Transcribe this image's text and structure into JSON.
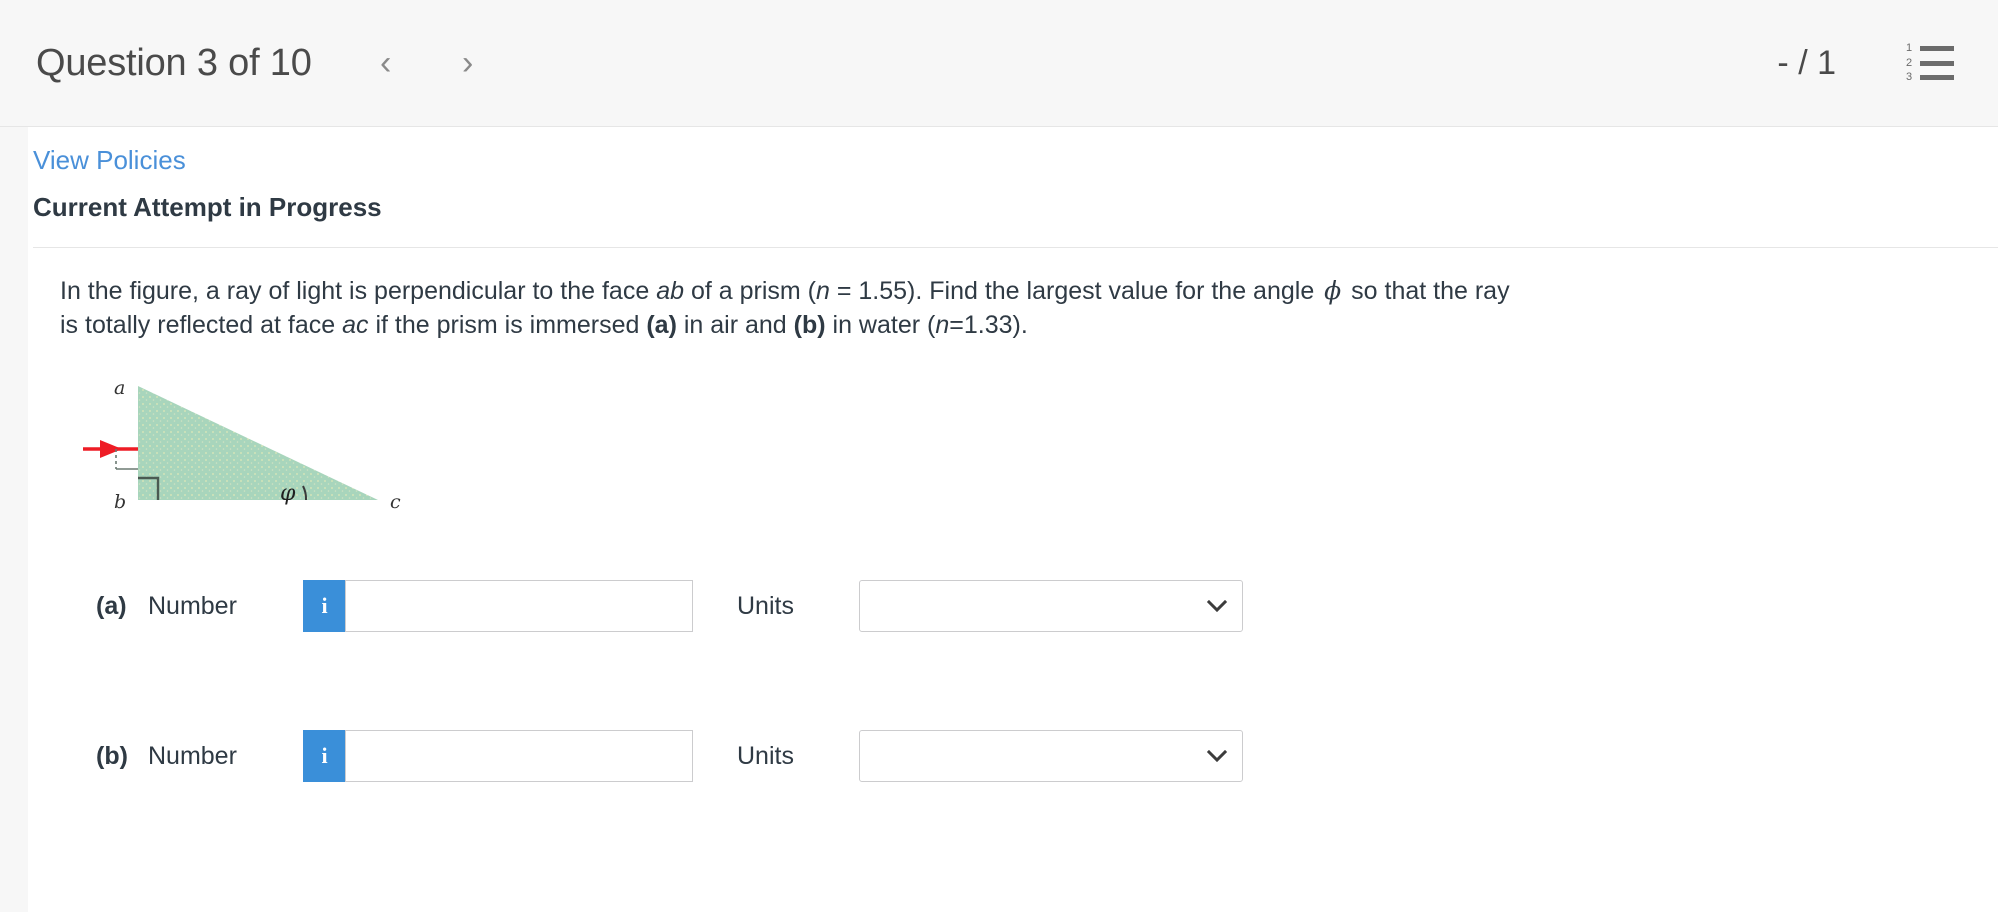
{
  "header": {
    "question_title": "Question 3 of 10",
    "prev_icon": "chevron-left-icon",
    "next_icon": "chevron-right-icon",
    "prev_glyph": "‹",
    "next_glyph": "›",
    "score": "- / 1",
    "list_icon": "numbered-list-icon",
    "list_numbers": [
      "1",
      "2",
      "3"
    ],
    "background": "#f7f7f7"
  },
  "policies": {
    "link_label": "View Policies",
    "link_color": "#4a90d9"
  },
  "attempt": {
    "heading": "Current Attempt in Progress"
  },
  "question": {
    "line1_part1": "In the figure, a ray of light is perpendicular to the face ",
    "italic_ab": "ab",
    "line1_part2": " of a prism (",
    "italic_n1": "n",
    "line1_part3": " = 1.55). Find the largest value for the angle ",
    "phi_symbol": "ϕ",
    "line1_part4": " so that the ray is totally reflected at face ",
    "italic_ac": "ac",
    "line1_part5": " if the prism is immersed ",
    "bold_a": "(a)",
    "line1_part6": " in air and ",
    "bold_b": "(b)",
    "line1_part7": " in water (",
    "italic_n2": "n",
    "line1_part8": "=1.33)."
  },
  "figure": {
    "name": "prism-diagram",
    "vertex_a": "a",
    "vertex_b": "b",
    "vertex_c": "c",
    "angle_label": "ϕ",
    "prism_fill": "#a8d5bc",
    "ray_color": "#ee1c25",
    "outline_color": "#4a5a52"
  },
  "answers": {
    "rows": [
      {
        "part": "(a)",
        "number_label": "Number",
        "info_icon": "info-icon",
        "info_glyph": "i",
        "number_value": "",
        "number_placeholder": "",
        "units_label": "Units",
        "units_value": "",
        "units_options": [
          ""
        ],
        "chevron_icon": "chevron-down-icon"
      },
      {
        "part": "(b)",
        "number_label": "Number",
        "info_icon": "info-icon",
        "info_glyph": "i",
        "number_value": "",
        "number_placeholder": "",
        "units_label": "Units",
        "units_value": "",
        "units_options": [
          ""
        ],
        "chevron_icon": "chevron-down-icon"
      }
    ]
  }
}
